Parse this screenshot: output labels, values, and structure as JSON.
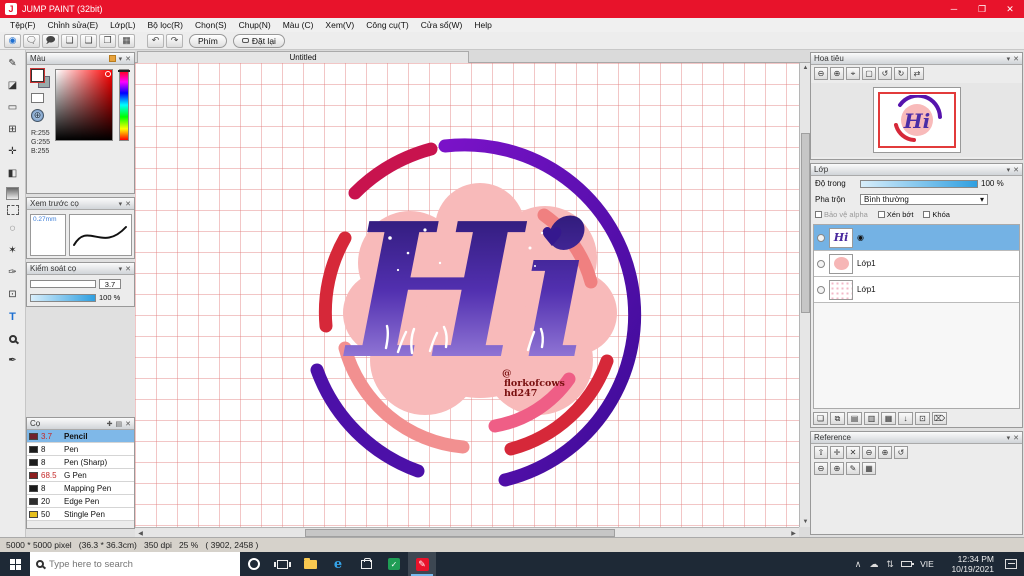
{
  "titlebar": {
    "title": "JUMP PAINT (32bit)"
  },
  "menu": {
    "items": [
      "Tệp(F)",
      "Chỉnh sửa(E)",
      "Lớp(L)",
      "Bộ lọc(R)",
      "Chọn(S)",
      "Chụp(N)",
      "Màu (C)",
      "Xem(V)",
      "Công cụ(T)",
      "Cửa sổ(W)",
      "Help"
    ]
  },
  "toolbar": {
    "phim_label": "Phím",
    "reset_label": "Đặt lại"
  },
  "color_panel": {
    "title": "Màu",
    "r": "R:255",
    "g": "G:255",
    "b": "B:255"
  },
  "brush_preview_panel": {
    "title": "Xem trước cọ",
    "size": "0.27mm"
  },
  "brush_control_panel": {
    "title": "Kiểm soát cọ",
    "size_value": "3.7",
    "opacity_value": "100 %"
  },
  "brush_panel": {
    "title": "Cọ",
    "brushes": [
      {
        "size": "3.7",
        "name": "Pencil",
        "chip_style": "background:#71212d",
        "size_style": "color:#c42727"
      },
      {
        "size": "8",
        "name": "Pen",
        "chip_style": "background:#1c1c1c",
        "size_style": "color:#222"
      },
      {
        "size": "8",
        "name": "Pen (Sharp)",
        "chip_style": "background:#1c1c1c",
        "size_style": "color:#222"
      },
      {
        "size": "68.5",
        "name": "G Pen",
        "chip_style": "background:#8d1f1f",
        "size_style": "color:#c42727"
      },
      {
        "size": "8",
        "name": "Mapping Pen",
        "chip_style": "background:#1c1c1c",
        "size_style": "color:#222"
      },
      {
        "size": "20",
        "name": "Edge Pen",
        "chip_style": "background:#2e2e2e",
        "size_style": "color:#222"
      },
      {
        "size": "50",
        "name": "Stingle Pen",
        "chip_style": "background:#e5bf1e",
        "size_style": "color:#222"
      }
    ]
  },
  "canvas": {
    "tab": "Untitled",
    "word": "Hi",
    "credit1": "@",
    "credit2": "florkofcows",
    "credit3": "hd247"
  },
  "navigator": {
    "title": "Hoa tiêu"
  },
  "layers_panel": {
    "title": "Lớp",
    "opacity_label": "Độ trong",
    "opacity_value": "100 %",
    "blend_label": "Pha trộn",
    "blend_value": "Bình thường",
    "alpha_label": "Bảo vệ alpha",
    "clip_label": "Xén bớt",
    "lock_label": "Khóa",
    "items": [
      {
        "name": ""
      },
      {
        "name": "Lớp1"
      },
      {
        "name": "Lớp1"
      }
    ]
  },
  "reference_panel": {
    "title": "Reference"
  },
  "statusbar": {
    "text": "5000 * 5000 pixel   (36.3 * 36.3cm)   350 dpi   25 %   ( 3902, 2458 )"
  },
  "taskbar": {
    "search_placeholder": "Type here to search",
    "lang": "VIE",
    "time": "12:34 PM",
    "date": "10/19/2021"
  }
}
